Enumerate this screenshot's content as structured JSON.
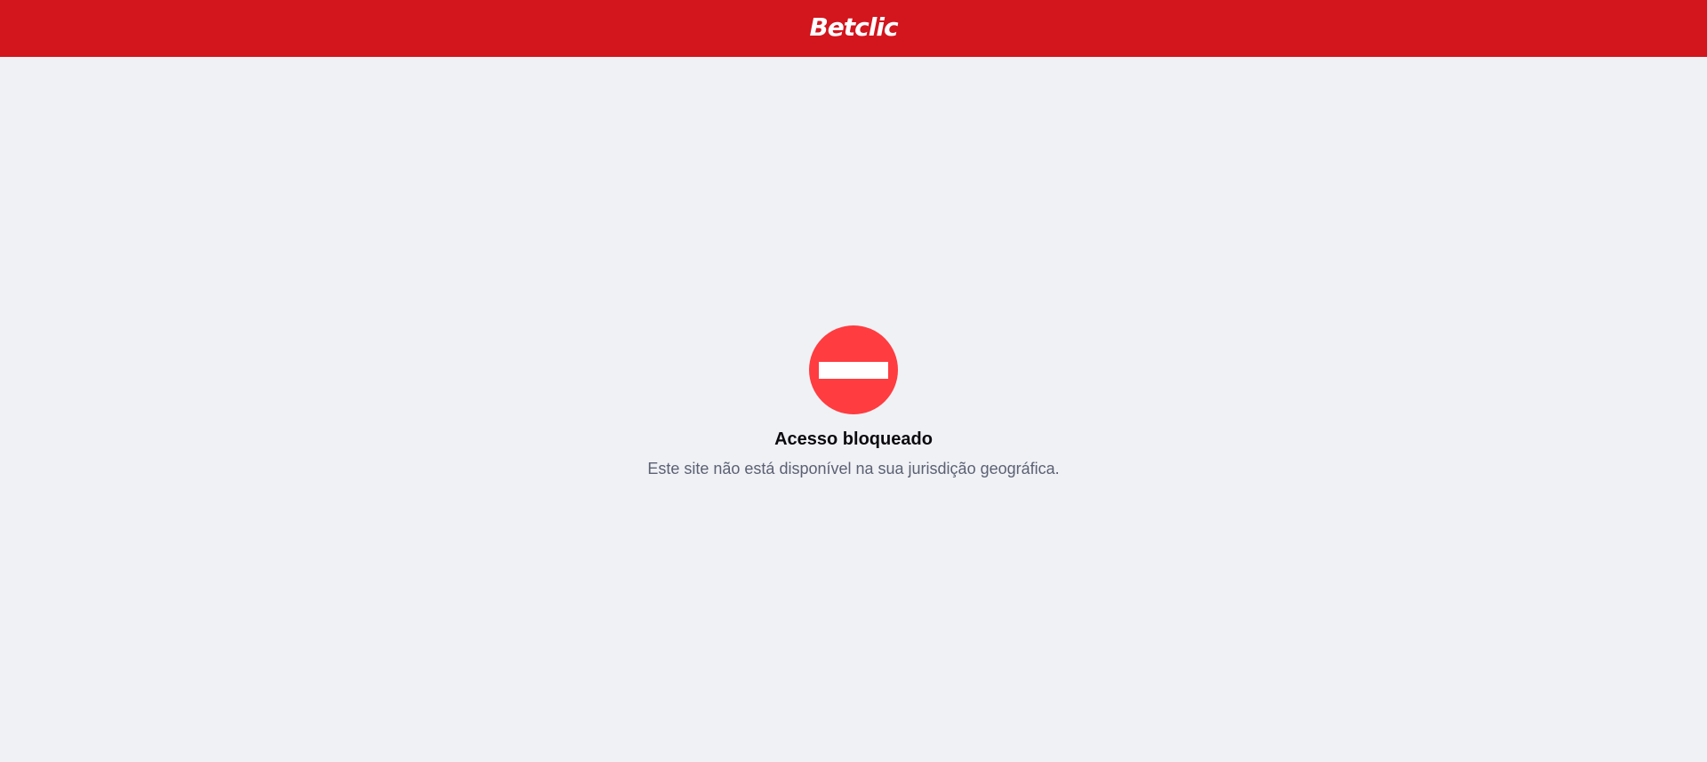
{
  "header": {
    "logo_text": "Betclic",
    "background_color": "#d3151e"
  },
  "main": {
    "icon": "no-entry-icon",
    "icon_color": "#ff3c40",
    "title": "Acesso bloqueado",
    "message": "Este site não está disponível na sua jurisdição geográfica."
  }
}
